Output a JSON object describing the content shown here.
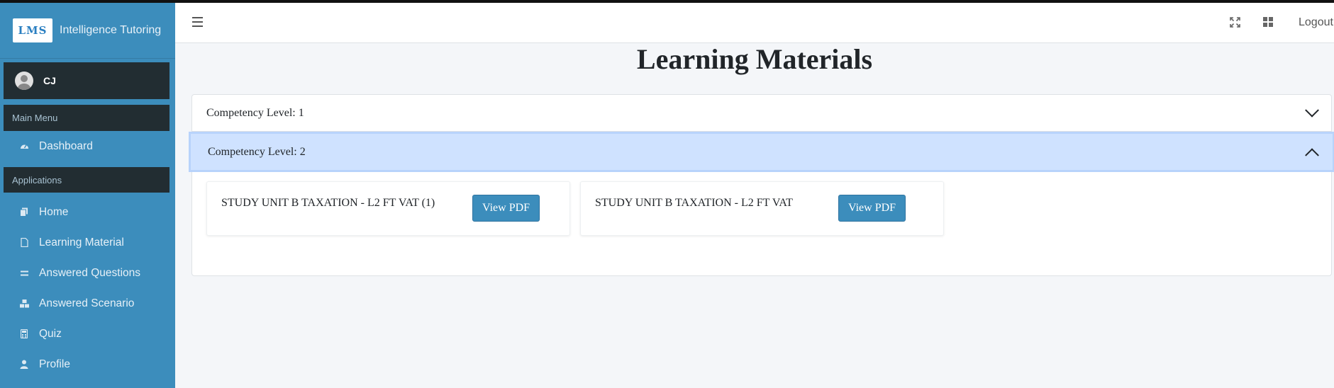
{
  "brand": {
    "logo_text": "LMS",
    "name": "Intelligence Tutoring"
  },
  "user": {
    "name": "CJ"
  },
  "sidebar": {
    "main_menu_header": "Main Menu",
    "main_items": [
      {
        "label": "Dashboard",
        "icon": "dashboard-icon"
      }
    ],
    "applications_header": "Applications",
    "app_items": [
      {
        "label": "Home",
        "icon": "copy-icon"
      },
      {
        "label": "Learning Material",
        "icon": "file-icon"
      },
      {
        "label": "Answered Questions",
        "icon": "equals-icon"
      },
      {
        "label": "Answered Scenario",
        "icon": "boxes-icon"
      },
      {
        "label": "Quiz",
        "icon": "calculator-icon"
      },
      {
        "label": "Profile",
        "icon": "user-icon"
      }
    ]
  },
  "header": {
    "logout_label": "Logout"
  },
  "page": {
    "title": "Learning Materials"
  },
  "accordion": {
    "sections": [
      {
        "label": "Competency Level: 1",
        "expanded": false
      },
      {
        "label": "Competency Level: 2",
        "expanded": true
      }
    ],
    "materials": [
      {
        "title": "STUDY UNIT B TAXATION - L2 FT VAT (1)",
        "button_label": "View PDF"
      },
      {
        "title": "STUDY UNIT B TAXATION - L2 FT VAT",
        "button_label": "View PDF"
      }
    ]
  },
  "colors": {
    "sidebar": "#3c8dbc",
    "sidebar_dark": "#222d32",
    "accordion_active": "#cfe2ff",
    "button": "#3c8dbc"
  }
}
